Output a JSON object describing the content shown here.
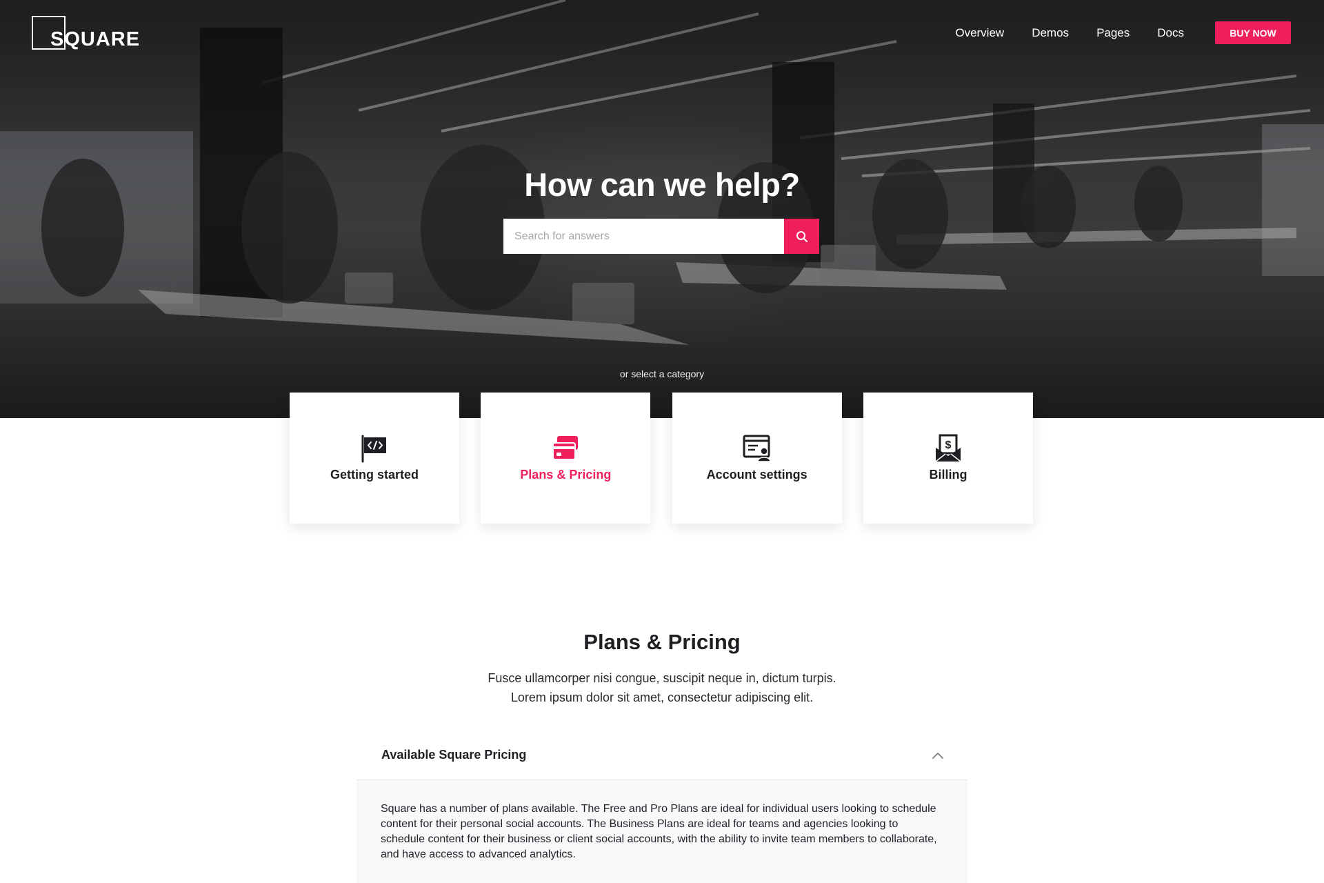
{
  "header": {
    "logo_text": "SQUARE",
    "nav": [
      "Overview",
      "Demos",
      "Pages",
      "Docs"
    ],
    "cta_label": "BUY NOW"
  },
  "hero": {
    "title": "How can we help?",
    "search_placeholder": "Search for answers",
    "hint": "or select a category"
  },
  "categories": [
    {
      "label": "Getting started",
      "icon": "code-flag-icon",
      "active": false
    },
    {
      "label": "Plans & Pricing",
      "icon": "credit-cards-icon",
      "active": true
    },
    {
      "label": "Account settings",
      "icon": "account-browser-icon",
      "active": false
    },
    {
      "label": "Billing",
      "icon": "billing-envelope-icon",
      "active": false
    }
  ],
  "section": {
    "title": "Plans & Pricing",
    "subtitle_line1": "Fusce ullamcorper nisi congue, suscipit neque in, dictum turpis.",
    "subtitle_line2": "Lorem ipsum dolor sit amet, consectetur adipiscing elit."
  },
  "accordion": {
    "title": "Available Square Pricing",
    "expanded": true,
    "body": "Square has a number of plans available. The Free and Pro Plans are ideal for individual users looking to schedule content for their personal social accounts. The Business Plans are ideal for teams and agencies looking to schedule content for their business or client social accounts, with the ability to invite team members to collaborate, and have access to advanced analytics."
  },
  "colors": {
    "accent": "#ee1f5b",
    "text": "#1f1f23",
    "accordion_bg": "#f8f7fa"
  }
}
